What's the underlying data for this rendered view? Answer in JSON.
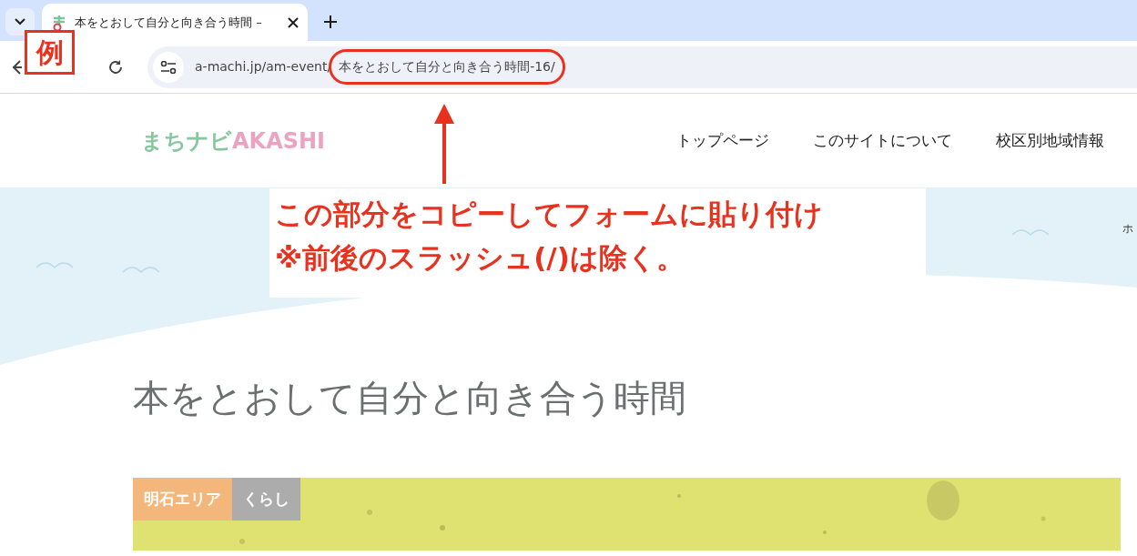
{
  "browser": {
    "tab": {
      "title": "本をとおして自分と向き合う時間 –",
      "selected": true
    },
    "url_base": "a-machi.jp/am-event/",
    "url_slug": "本をとおして自分と向き合う時間-16/"
  },
  "annotation": {
    "example_label": "例",
    "note_lines": [
      "この部分をコピーしてフォームに貼り付け",
      "※前後のスラッシュ(/)は除く。"
    ]
  },
  "site": {
    "logo_jp": "まちナビ",
    "logo_en": "AKASHI",
    "nav": [
      {
        "label": "トップページ"
      },
      {
        "label": "このサイトについて"
      },
      {
        "label": "校区別地域情報"
      }
    ],
    "side_text": "ホ"
  },
  "article": {
    "title": "本をとおして自分と向き合う時間",
    "tags": [
      {
        "label": "明石エリア",
        "color": "#f3b77c"
      },
      {
        "label": "くらし",
        "color": "#acacac"
      }
    ]
  }
}
